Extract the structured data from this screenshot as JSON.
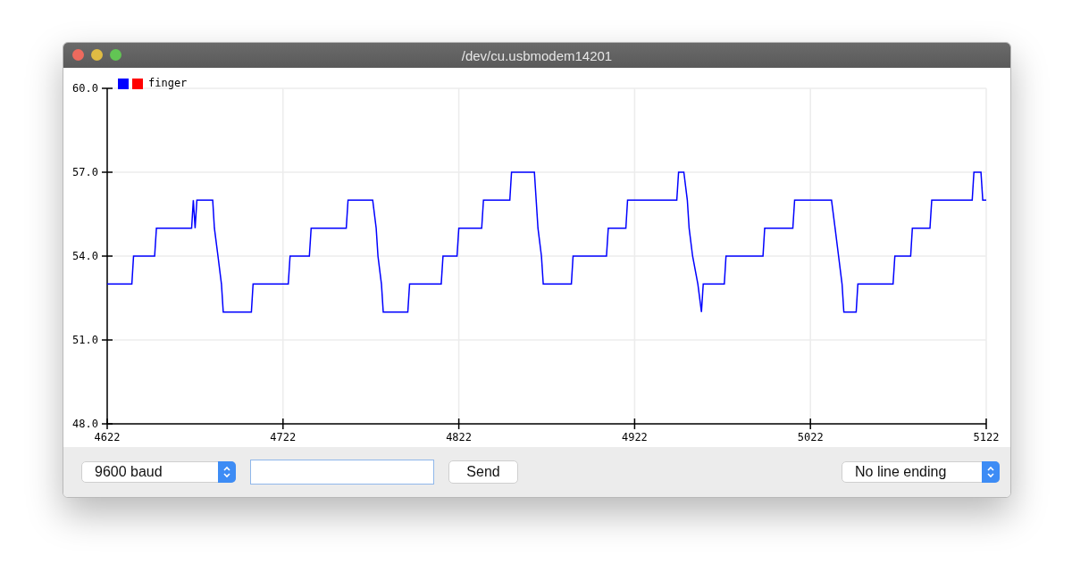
{
  "window": {
    "title": "/dev/cu.usbmodem14201"
  },
  "plot": {
    "legend": [
      {
        "color": "#0000ff"
      },
      {
        "color": "#ff0000"
      }
    ],
    "chart_data": {
      "type": "line",
      "grid": true,
      "x": [
        4622,
        4636,
        4637,
        4649,
        4650,
        4670,
        4671,
        4672,
        4673,
        4682,
        4683,
        4685,
        4687,
        4688,
        4704,
        4705,
        4725,
        4726,
        4737,
        4738,
        4758,
        4759,
        4773,
        4775,
        4776,
        4778,
        4779,
        4793,
        4794,
        4812,
        4813,
        4821,
        4822,
        4835,
        4836,
        4851,
        4852,
        4865,
        4866,
        4867,
        4869,
        4870,
        4886,
        4887,
        4906,
        4907,
        4917,
        4918,
        4946,
        4947,
        4950,
        4952,
        4953,
        4955,
        4958,
        4960,
        4961,
        4973,
        4974,
        4995,
        4996,
        5012,
        5013,
        5034,
        5036,
        5038,
        5040,
        5041,
        5048,
        5049,
        5069,
        5070,
        5079,
        5080,
        5090,
        5091,
        5114,
        5115,
        5119,
        5120,
        5122
      ],
      "series": [
        {
          "name": "finger",
          "color": "#0000ff",
          "values": [
            53,
            53,
            54,
            54,
            55,
            55,
            56,
            55,
            56,
            56,
            55,
            54,
            53,
            52,
            52,
            53,
            53,
            54,
            54,
            55,
            55,
            56,
            56,
            55,
            54,
            53,
            52,
            52,
            53,
            53,
            54,
            54,
            55,
            55,
            56,
            56,
            57,
            57,
            56,
            55,
            54,
            53,
            53,
            54,
            54,
            55,
            55,
            56,
            56,
            57,
            57,
            56,
            55,
            54,
            53,
            52,
            53,
            53,
            54,
            54,
            55,
            55,
            56,
            56,
            55,
            54,
            53,
            52,
            52,
            53,
            53,
            54,
            54,
            55,
            55,
            56,
            56,
            57,
            57,
            56,
            56
          ]
        }
      ],
      "xlim": [
        4622,
        5122
      ],
      "ylim": [
        48,
        60
      ],
      "xticks": [
        4622,
        4722,
        4822,
        4922,
        5022,
        5122
      ],
      "yticks": [
        {
          "value": 48,
          "label": "48.0"
        },
        {
          "value": 51,
          "label": "51.0"
        },
        {
          "value": 54,
          "label": "54.0"
        },
        {
          "value": 57,
          "label": "57.0"
        },
        {
          "value": 60,
          "label": "60.0"
        }
      ]
    }
  },
  "controls": {
    "baud": "9600 baud",
    "send": "Send",
    "line_ending": "No line ending"
  }
}
